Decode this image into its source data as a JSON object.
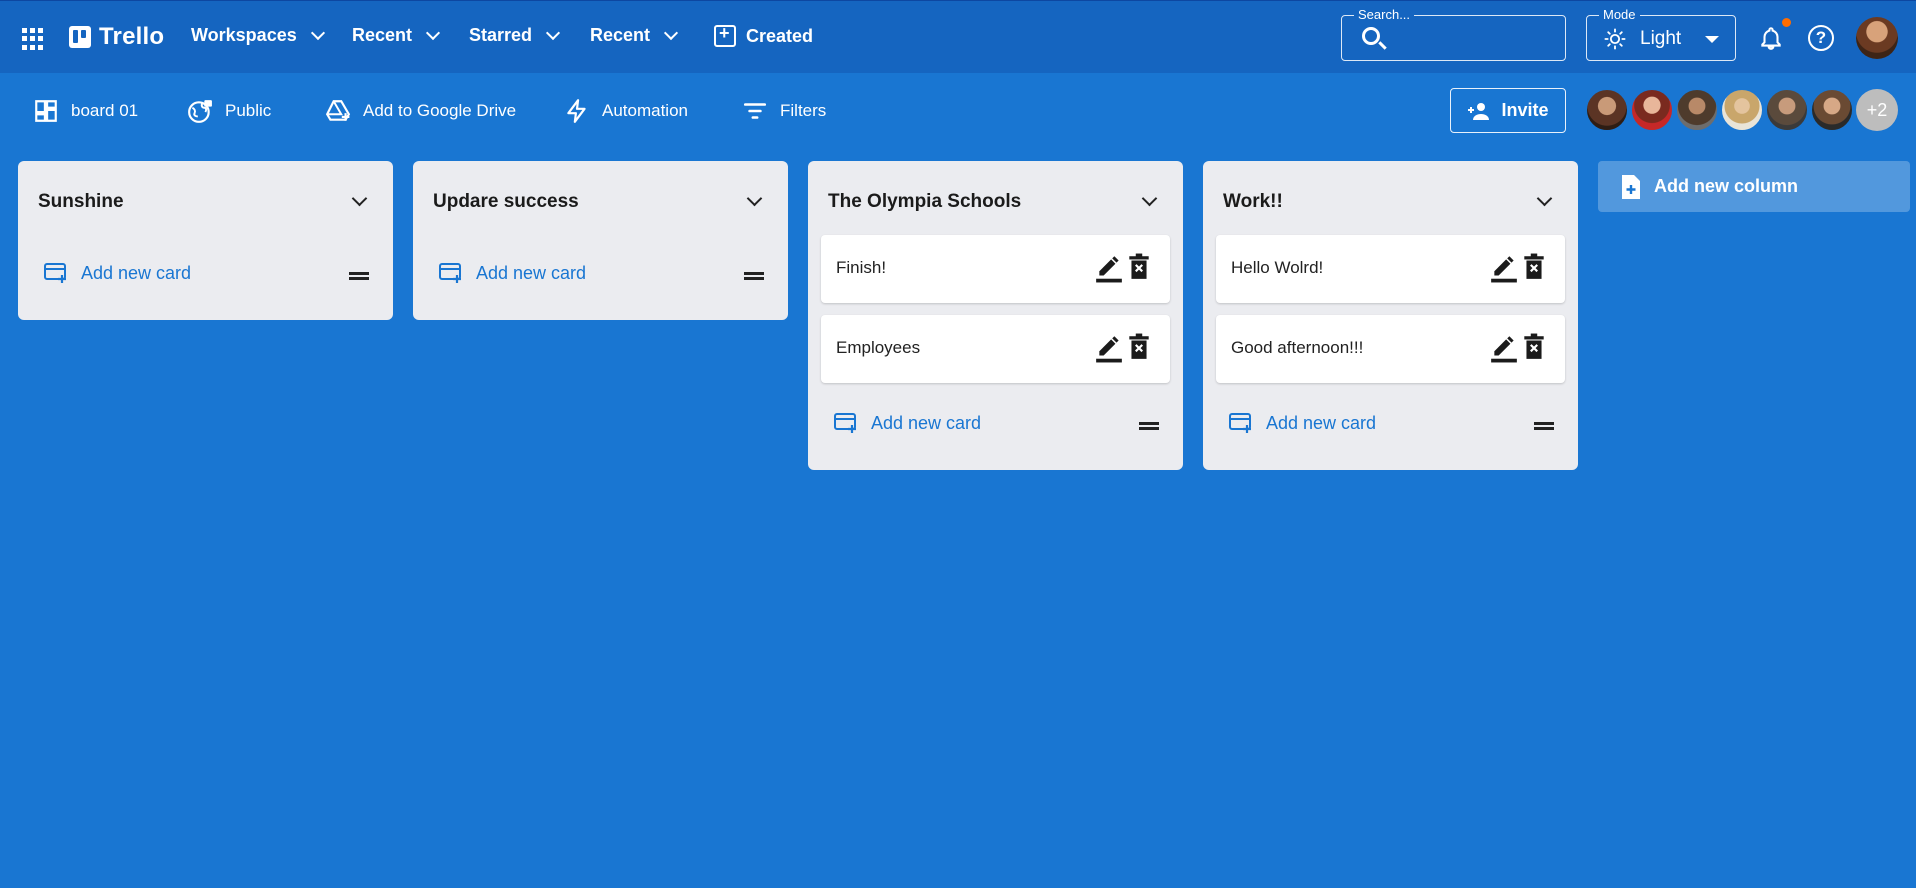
{
  "appbar": {
    "brand": "Trello",
    "nav": [
      "Workspaces",
      "Recent",
      "Starred",
      "Recent"
    ],
    "created": "Created",
    "search_legend": "Search...",
    "mode_legend": "Mode",
    "mode_value": "Light"
  },
  "boardbar": {
    "board_name": "board 01",
    "visibility": "Public",
    "drive": "Add to Google Drive",
    "automation": "Automation",
    "filters": "Filters",
    "invite": "Invite",
    "more_members": "+2"
  },
  "columns": [
    {
      "title": "Sunshine",
      "cards": []
    },
    {
      "title": "Updare success",
      "cards": []
    },
    {
      "title": "The Olympia Schools",
      "cards": [
        "Finish!",
        "Employees"
      ]
    },
    {
      "title": "Work!!",
      "cards": [
        "Hello Wolrd!",
        "Good afternoon!!!"
      ]
    }
  ],
  "add_card_label": "Add new card",
  "add_column_label": "Add new column",
  "colors": {
    "primary": "#1976d2",
    "appbar": "#1565c0",
    "column_bg": "#ebecf0",
    "notification": "#ff6d00"
  },
  "icons": [
    "apps-icon",
    "trello-logo-icon",
    "chevron-down-icon",
    "add-box-icon",
    "search-icon",
    "sun-icon",
    "bell-icon",
    "help-icon",
    "dashboard-icon",
    "public-icon",
    "add-to-drive-icon",
    "bolt-icon",
    "filter-icon",
    "person-add-icon",
    "edit-icon",
    "delete-icon",
    "add-card-icon",
    "drag-handle-icon",
    "note-add-icon"
  ]
}
